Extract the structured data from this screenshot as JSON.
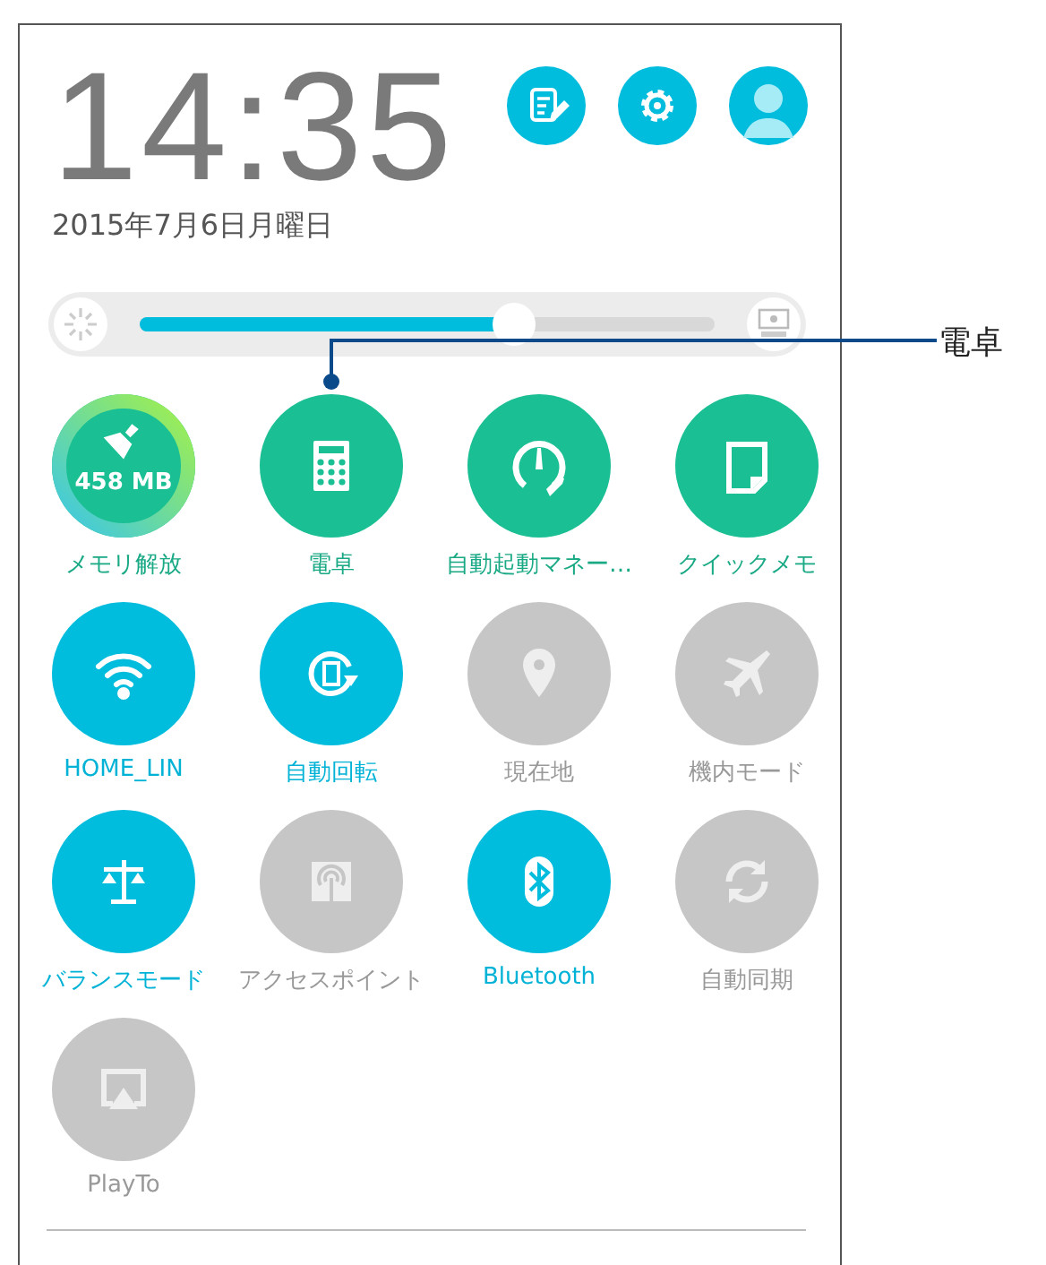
{
  "clock": {
    "time": "14:35",
    "date": "2015年7月6日月曜日"
  },
  "brightness": {
    "level": 0.65
  },
  "callout": {
    "label": "電卓"
  },
  "tiles": [
    {
      "kind": "memory",
      "label": "メモリ解放",
      "reading": "458 MB"
    },
    {
      "kind": "calculator",
      "label": "電卓"
    },
    {
      "kind": "autostart",
      "label": "自動起動マネー…"
    },
    {
      "kind": "memo",
      "label": "クイックメモ"
    },
    {
      "kind": "wifi",
      "label": "HOME_LIN",
      "on": true
    },
    {
      "kind": "rotate",
      "label": "自動回転",
      "on": true
    },
    {
      "kind": "location",
      "label": "現在地",
      "on": false
    },
    {
      "kind": "airplane",
      "label": "機内モード",
      "on": false
    },
    {
      "kind": "balance",
      "label": "バランスモード",
      "on": true
    },
    {
      "kind": "hotspot",
      "label": "アクセスポイント",
      "on": false
    },
    {
      "kind": "bluetooth",
      "label": "Bluetooth",
      "on": true
    },
    {
      "kind": "sync",
      "label": "自動同期",
      "on": false
    },
    {
      "kind": "playto",
      "label": "PlayTo",
      "on": false
    }
  ]
}
